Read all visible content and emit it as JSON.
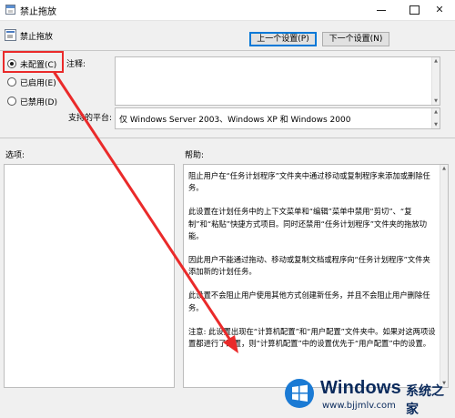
{
  "window": {
    "title": "禁止拖放"
  },
  "header": {
    "policy_name": "禁止拖放",
    "prev_button": "上一个设置(P)",
    "next_button": "下一个设置(N)"
  },
  "radios": [
    {
      "label": "未配置(C)",
      "selected": true
    },
    {
      "label": "已启用(E)",
      "selected": false
    },
    {
      "label": "已禁用(D)",
      "selected": false
    }
  ],
  "fields": {
    "comment_label": "注释:",
    "comment_value": "",
    "platform_label": "支持的平台:",
    "platform_value": "仅 Windows Server 2003、Windows XP 和 Windows 2000"
  },
  "panes": {
    "options_label": "选项:",
    "help_label": "帮助:",
    "help_paragraphs": [
      "阻止用户在“任务计划程序”文件夹中通过移动或复制程序来添加或删除任务。",
      "此设置在计划任务中的上下文菜单和“编辑”菜单中禁用“剪切”、“复制”和“粘贴”快捷方式项目。同时还禁用“任务计划程序”文件夹的拖放功能。",
      "因此用户不能通过拖动、移动或复制文档或程序向“任务计划程序”文件夹添加新的计划任务。",
      "此设置不会阻止用户使用其他方式创建新任务，并且不会阻止用户删除任务。",
      "注意: 此设置出现在“计算机配置”和“用户配置”文件夹中。如果对这两项设置都进行了配置，则“计算机配置”中的设置优先于“用户配置”中的设置。"
    ]
  },
  "watermark": {
    "brand": "Windows",
    "cn": "系统之家",
    "url": "www.bjjmlv.com"
  },
  "colors": {
    "annotation": "#ea2a2a",
    "accent": "#0078d7"
  }
}
